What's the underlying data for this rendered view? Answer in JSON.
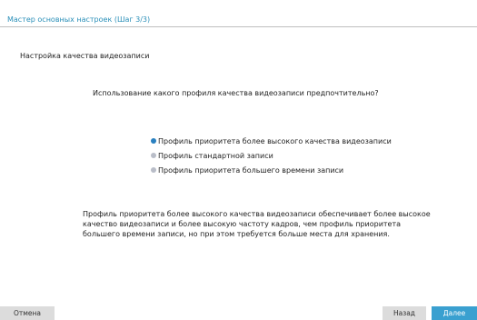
{
  "window": {
    "title": "Мастер основных настроек  (Шаг  3/3)"
  },
  "section": {
    "heading": "Настройка качества видеозаписи"
  },
  "question": "Использование какого профиля качества видеозаписи предпочтительно?",
  "options": [
    {
      "label": "Профиль приоритета более высокого качества видеозаписи",
      "selected": true
    },
    {
      "label": "Профиль стандартной записи",
      "selected": false
    },
    {
      "label": "Профиль приоритета большего времени записи",
      "selected": false
    }
  ],
  "description": {
    "lines": [
      "Профиль приоритета более высокого качества видеозаписи обеспечивает более высокое",
      "качество видеозаписи и более высокую частоту кадров, чем профиль приоритета",
      "большего времени записи, но при этом требуется больше места для хранения."
    ]
  },
  "buttons": {
    "cancel": "Отмена",
    "back": "Назад",
    "next": "Далее"
  },
  "colors": {
    "title": "#2a8fb8",
    "radio_selected": "#2a80c0",
    "radio_unselected": "#b9bdc8",
    "next_button": "#3aa0d0",
    "secondary_button": "#dcdcdc"
  }
}
